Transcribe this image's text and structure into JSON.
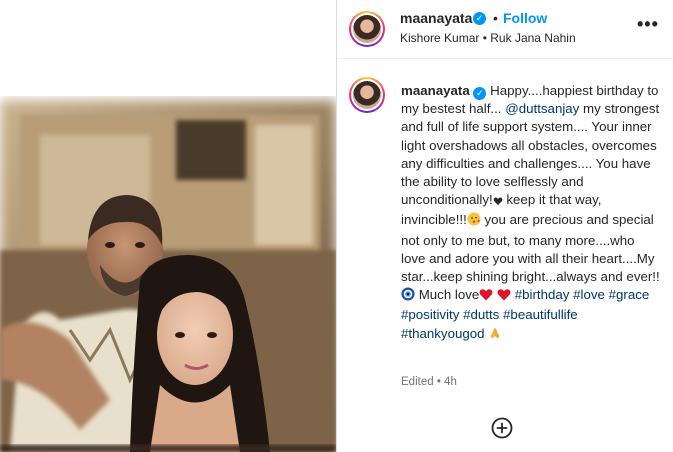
{
  "post": {
    "username": "maanayata",
    "verified_mark": "✓",
    "follow_label": "Follow",
    "separator": "•",
    "music": {
      "artist": "Kishore Kumar",
      "dot": "•",
      "song": "Ruk Jana Nahin"
    },
    "more_label": "•••"
  },
  "caption": {
    "username": "maanayata",
    "text_1": "Happy....happiest birthday to my bestest half...",
    "mention": "@duttsanjay",
    "text_2": "my strongest and full of life support system.... Your inner light overshadows all obstacles, overcomes any difficulties and challenges.... You have the ability to love selflessly and unconditionally!",
    "text_3": "keep it that way, invincible!!!",
    "text_4": "you are precious and special not only to me but, to many more....who love and adore you with all their heart....My star...keep shining bright...always and ever!!",
    "text_5": "Much love",
    "hashtags": [
      "#birthday",
      "#love",
      "#grace",
      "#positivity",
      "#dutts",
      "#beautifullife",
      "#thankyougod"
    ],
    "edited_label": "Edited",
    "time": "4h"
  },
  "icons": [
    "verified-badge-icon",
    "more-options-icon",
    "heart-icon",
    "kiss-emoji-icon",
    "evil-eye-icon",
    "praying-hands-icon",
    "add-comment-icon"
  ]
}
